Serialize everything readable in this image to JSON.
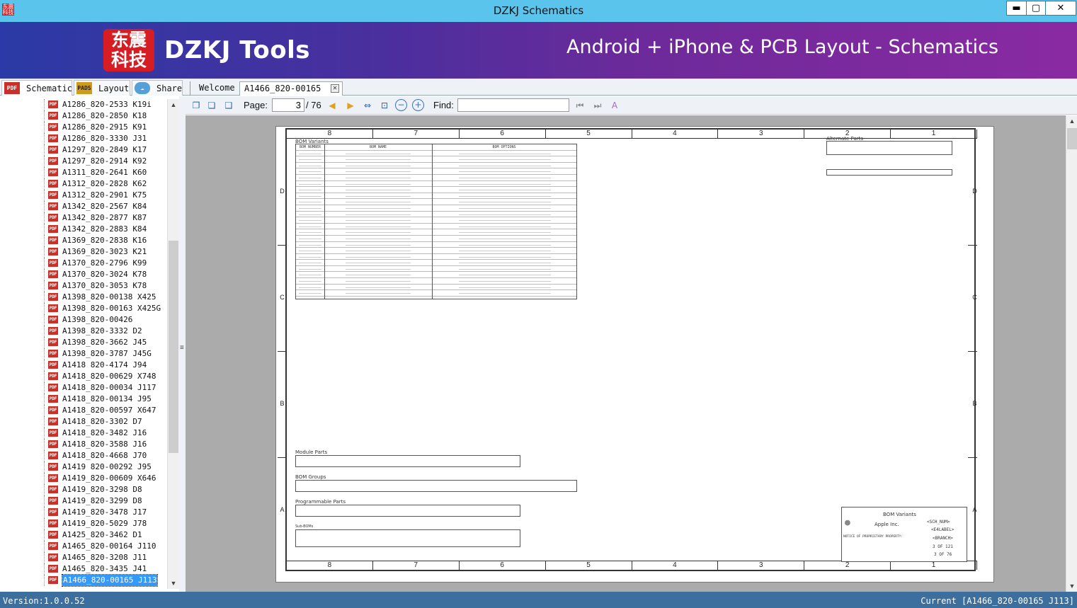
{
  "window": {
    "title": "DZKJ Schematics",
    "app_icon_text": "东震科技",
    "min_label": "▬",
    "max_label": "▢",
    "close_label": "✕"
  },
  "banner": {
    "logo_text": "东震科技",
    "brand": "DZKJ Tools",
    "tagline": "Android + iPhone & PCB Layout - Schematics"
  },
  "tabs": {
    "schematic": "Schematic",
    "layout": "Layout",
    "share": "Share",
    "welcome": "Welcome",
    "document": "A1466_820-00165 J113"
  },
  "icons": {
    "pdf": "pdf-icon",
    "pads": "pads-icon",
    "share": "share-icon"
  },
  "tree_items": [
    "A1286_820-2533 K19i",
    "A1286_820-2850 K18",
    "A1286_820-2915 K91",
    "A1286_820-3330 J31",
    "A1297_820-2849 K17",
    "A1297_820-2914 K92",
    "A1311_820-2641 K60",
    "A1312_820-2828 K62",
    "A1312_820-2901 K75",
    "A1342_820-2567 K84",
    "A1342_820-2877 K87",
    "A1342_820-2883 K84",
    "A1369_820-2838 K16",
    "A1369_820-3023 K21",
    "A1370_820-2796 K99",
    "A1370_820-3024 K78",
    "A1370_820-3053 K78",
    "A1398_820-00138 X425",
    "A1398_820-00163 X425G",
    "A1398_820-00426",
    "A1398_820-3332 D2",
    "A1398_820-3662 J45",
    "A1398_820-3787 J45G",
    "A1418 820-4174 J94",
    "A1418_820-00629 X748",
    "A1418_820-00034 J117",
    "A1418_820-00134 J95",
    "A1418_820-00597 X647",
    "A1418_820-3302 D7",
    "A1418_820-3482 J16",
    "A1418_820-3588 J16",
    "A1418_820-4668 J70",
    "A1419 820-00292 J95",
    "A1419_820-00609 X646",
    "A1419_820-3298 D8",
    "A1419_820-3299 D8",
    "A1419_820-3478 J17",
    "A1419_820-5029 J78",
    "A1425_820-3462 D1",
    "A1465_820-00164 J110",
    "A1465_820-3208 J11",
    "A1465_820-3435 J41",
    "A1466_820-00165 J113"
  ],
  "selected_index": 42,
  "toolbar": {
    "page_label": "Page:",
    "page_value": "3",
    "page_total": "/ 76",
    "find_label": "Find:",
    "find_value": ""
  },
  "schematic": {
    "zones_cols": [
      "8",
      "7",
      "6",
      "5",
      "4",
      "3",
      "2",
      "1"
    ],
    "zones_rows": [
      "D",
      "C",
      "B",
      "A"
    ],
    "bom_title": "BOM Variants",
    "bom_headers": [
      "BOM NUMBER",
      "BOM NAME",
      "BOM OPTIONS"
    ],
    "alternate_title": "Alternate Parts",
    "module_title": "Module Parts",
    "bom_groups_title": "BOM Groups",
    "programmable_title": "Programmable Parts",
    "subboms_title": "Sub-BOMs",
    "title_block_name": "BOM Variants",
    "company": "Apple Inc.",
    "sch_num": "<SCH_NUM>",
    "e4label": "<E4LABEL>",
    "branch": "<BRANCH>",
    "sheet": "3 OF 121",
    "page_of": "3 OF 76",
    "notice": "NOTICE OF PROPRIETARY PROPERTY:"
  },
  "status": {
    "version": "Version:1.0.0.52",
    "current": "Current [A1466_820-00165 J113]"
  }
}
